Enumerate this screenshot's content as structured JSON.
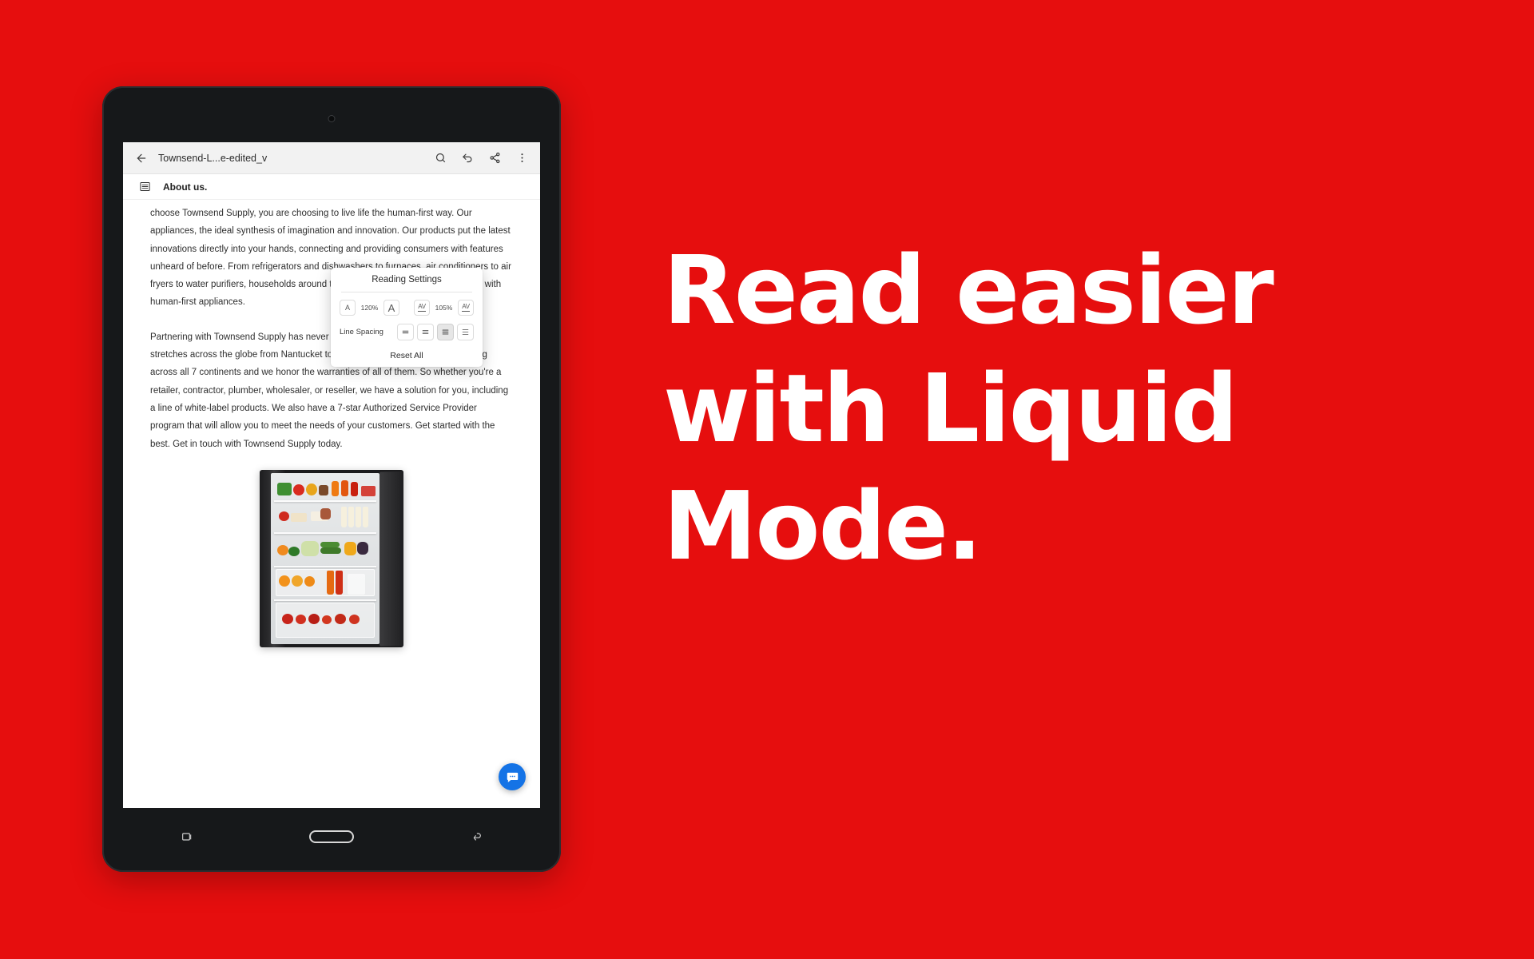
{
  "background_color": "#E60E0E",
  "headline": {
    "lines": [
      "Read easier",
      "with Liquid",
      "Mode."
    ],
    "color": "#FFFFFF"
  },
  "device": {
    "type": "android-tablet",
    "camera": "front-camera",
    "navbar": {
      "recents_label": "recents",
      "home_label": "home",
      "back_label": "back"
    }
  },
  "app": {
    "toolbar": {
      "back_icon": "back-arrow-icon",
      "document_title": "Townsend-L...e-edited_v",
      "search_icon": "search-icon",
      "undo_icon": "undo-icon",
      "share_icon": "share-icon",
      "overflow_icon": "more-vertical-icon"
    },
    "outline_bar": {
      "outline_icon": "outline-list-icon",
      "label": "About us."
    },
    "document": {
      "paragraphs": [
        "choose Townsend Supply, you are choosing to live life the human-first way. Our appliances, the ideal synthesis of imagination and innovation. Our products put the latest innovations directly into your hands, connecting and providing consumers with features unheard of before. From refrigerators and dishwashers to furnaces, air conditioners to air fryers to water purifiers, households around the world are living a life more human with human-first appliances.",
        "Partnering with Townsend Supply has never been easier. Our distribution network stretches across the globe from Nantucket to Timbuktu. Our products are operating across all 7 continents and we honor the warranties of all of them. So whether you're a retailer, contractor, plumber, wholesaler, or reseller, we have a solution for you, including a line of white-label products. We also have a 7-star Authorized Service Provider program that will allow you to meet the needs of your customers. Get started with the best. Get in touch with Townsend Supply today."
      ],
      "figure_alt": "open-refrigerator-photo"
    },
    "fab": {
      "icon": "chat-bubble-icon",
      "color": "#1473E6"
    },
    "reading_settings": {
      "title": "Reading Settings",
      "font_size": {
        "decrease_label": "A",
        "value": "120%",
        "increase_label": "A"
      },
      "letter_spacing": {
        "decrease_label": "AV",
        "value": "105%",
        "increase_label": "AV"
      },
      "line_spacing": {
        "label": "Line Spacing",
        "options": [
          "compact",
          "normal",
          "relaxed",
          "loose"
        ],
        "selected_index": 2
      },
      "reset_label": "Reset All"
    }
  }
}
